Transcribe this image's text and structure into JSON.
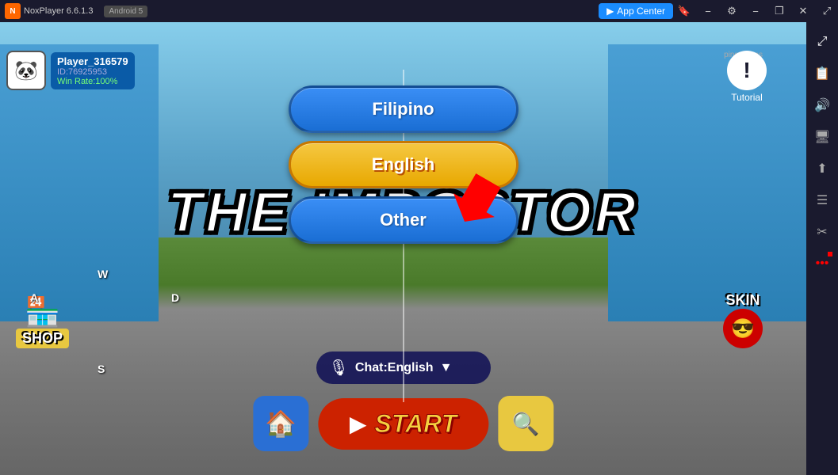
{
  "titlebar": {
    "logo_text": "nox",
    "version": "NoxPlayer 6.6.1.3",
    "android_badge": "Android 5",
    "app_center": "App Center",
    "minimize": "−",
    "restore": "❐",
    "close": "✕",
    "expand": "⤢"
  },
  "sidebar": {
    "icons": [
      "⤢",
      "📋",
      "🔊",
      "🖥",
      "⬆",
      "≡",
      "✂",
      "•••"
    ]
  },
  "player": {
    "name": "Player_316579",
    "id": "ID:76925953",
    "win_rate": "Win Rate:100%",
    "avatar": "🐼"
  },
  "ping": "ping: 92ms",
  "tutorial_label": "Tutorial",
  "shop_label": "SHOP",
  "skin_label": "SKIN",
  "chat": {
    "text": "Chat:English"
  },
  "start_label": "START",
  "game_title": "THE IMPOSTOR",
  "language_buttons": {
    "filipino": "Filipino",
    "english": "English",
    "other": "Other"
  },
  "kbd": {
    "w": "W",
    "a": "A",
    "s": "S",
    "d": "D"
  }
}
